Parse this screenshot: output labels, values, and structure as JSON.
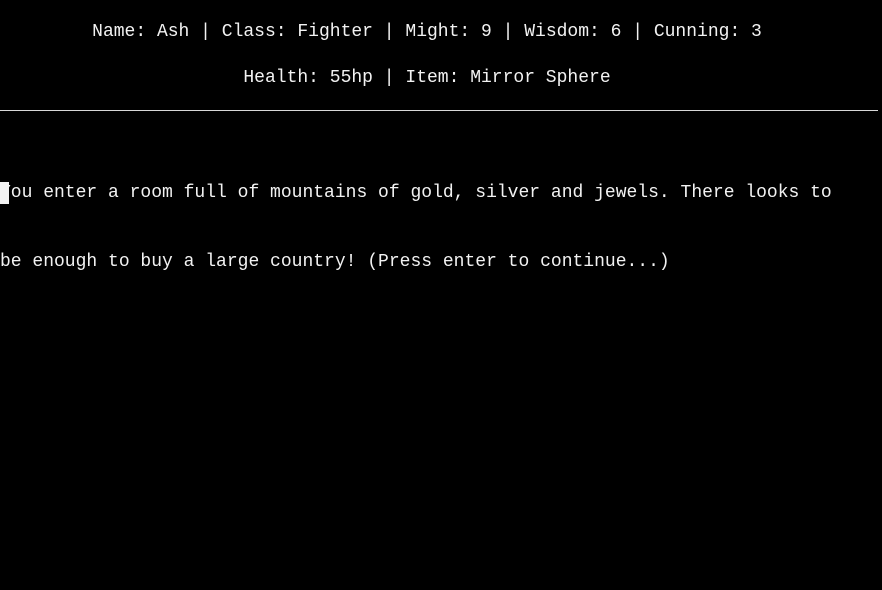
{
  "status": {
    "line1": "Name: Ash | Class: Fighter | Might: 9 | Wisdom: 6 | Cunning: 3",
    "line2": "Health: 55hp | Item: Mirror Sphere"
  },
  "narrative": {
    "line1": "You enter a room full of mountains of gold, silver and jewels. There looks to",
    "line2": "be enough to buy a large country! (Press enter to continue...)"
  },
  "colors": {
    "background": "#000000",
    "text": "#f2f2f2"
  }
}
